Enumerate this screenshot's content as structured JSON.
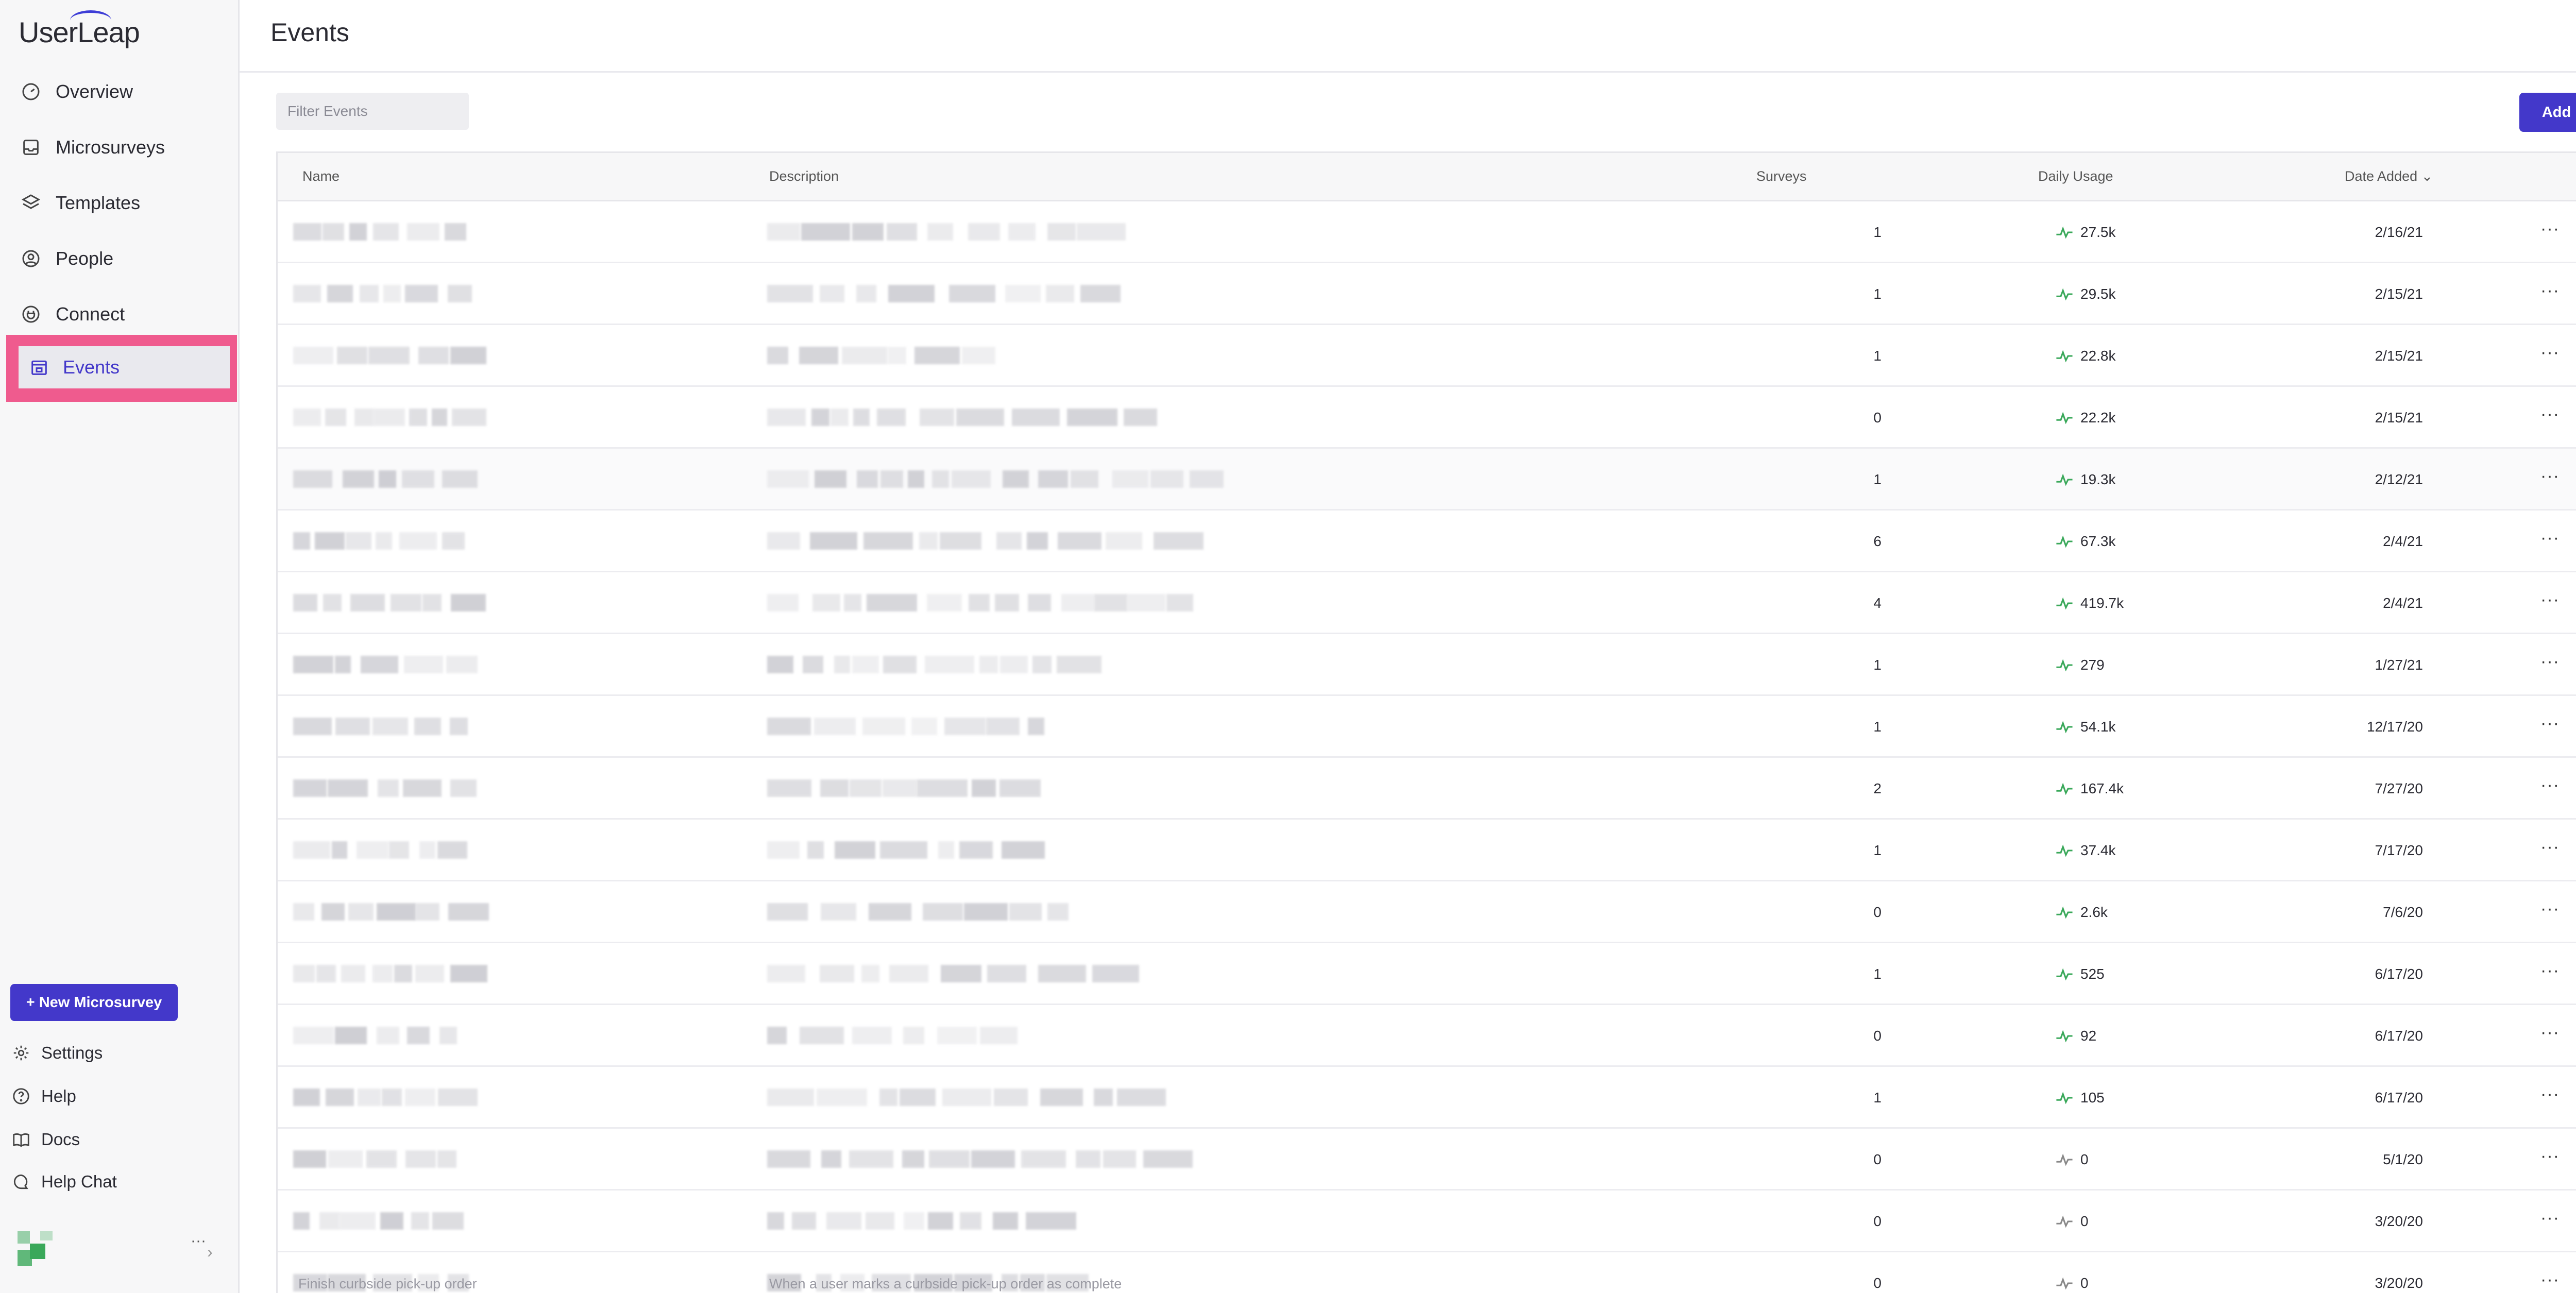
{
  "app": {
    "logo_text": "UserLeap"
  },
  "sidebar": {
    "items": [
      {
        "label": "Overview",
        "icon": "gauge-icon"
      },
      {
        "label": "Microsurveys",
        "icon": "inbox-icon"
      },
      {
        "label": "Templates",
        "icon": "layers-icon"
      },
      {
        "label": "People",
        "icon": "person-circle-icon"
      },
      {
        "label": "Connect",
        "icon": "plug-icon"
      },
      {
        "label": "Events",
        "icon": "calendar-icon",
        "active": true
      }
    ],
    "new_button": "+ New Microsurvey",
    "bottom": [
      {
        "label": "Settings",
        "icon": "gear-icon"
      },
      {
        "label": "Help",
        "icon": "help-icon"
      },
      {
        "label": "Docs",
        "icon": "book-icon"
      },
      {
        "label": "Help Chat",
        "icon": "chat-icon"
      }
    ],
    "user_more": "···",
    "user_chevron": "›"
  },
  "main": {
    "title": "Events",
    "filter_placeholder": "Filter Events",
    "add_label": "Add",
    "columns": {
      "name": "Name",
      "description": "Description",
      "surveys": "Surveys",
      "daily_usage": "Daily Usage",
      "date_added": "Date Added"
    },
    "sort_indicator": "⌄",
    "more": "···",
    "rows": [
      {
        "surveys": "1",
        "usage": "27.5k",
        "date": "2/16/21",
        "trend": "up"
      },
      {
        "surveys": "1",
        "usage": "29.5k",
        "date": "2/15/21",
        "trend": "up"
      },
      {
        "surveys": "1",
        "usage": "22.8k",
        "date": "2/15/21",
        "trend": "up"
      },
      {
        "surveys": "0",
        "usage": "22.2k",
        "date": "2/15/21",
        "trend": "up"
      },
      {
        "surveys": "1",
        "usage": "19.3k",
        "date": "2/12/21",
        "trend": "up"
      },
      {
        "surveys": "6",
        "usage": "67.3k",
        "date": "2/4/21",
        "trend": "up"
      },
      {
        "surveys": "4",
        "usage": "419.7k",
        "date": "2/4/21",
        "trend": "up"
      },
      {
        "surveys": "1",
        "usage": "279",
        "date": "1/27/21",
        "trend": "up"
      },
      {
        "surveys": "1",
        "usage": "54.1k",
        "date": "12/17/20",
        "trend": "up"
      },
      {
        "surveys": "2",
        "usage": "167.4k",
        "date": "7/27/20",
        "trend": "up"
      },
      {
        "surveys": "1",
        "usage": "37.4k",
        "date": "7/17/20",
        "trend": "up"
      },
      {
        "surveys": "0",
        "usage": "2.6k",
        "date": "7/6/20",
        "trend": "up"
      },
      {
        "surveys": "1",
        "usage": "525",
        "date": "6/17/20",
        "trend": "up"
      },
      {
        "surveys": "0",
        "usage": "92",
        "date": "6/17/20",
        "trend": "up"
      },
      {
        "surveys": "1",
        "usage": "105",
        "date": "6/17/20",
        "trend": "up"
      },
      {
        "surveys": "0",
        "usage": "0",
        "date": "5/1/20",
        "trend": "flat"
      },
      {
        "surveys": "0",
        "usage": "0",
        "date": "3/20/20",
        "trend": "flat"
      },
      {
        "surveys": "0",
        "usage": "0",
        "date": "3/20/20",
        "trend": "flat"
      }
    ],
    "partial_row": {
      "name": "Finish curbside pick-up order",
      "description": "When a user marks a curbside pick-up order as complete"
    }
  },
  "colors": {
    "accent": "#4338ca",
    "highlight": "#ef5b8e",
    "trend_up": "#3aa85a",
    "trend_flat": "#888888"
  }
}
